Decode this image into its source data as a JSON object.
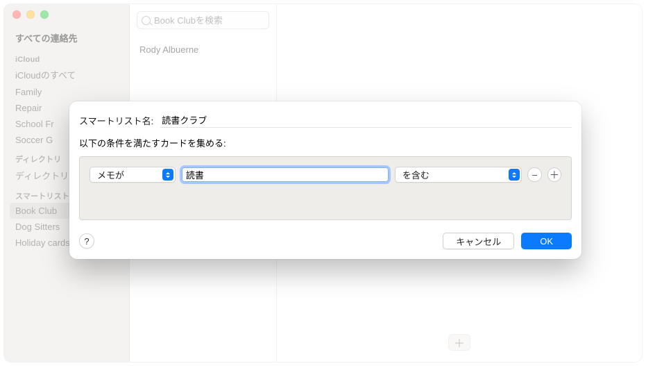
{
  "sidebar": {
    "title": "すべての連絡先",
    "sections": [
      {
        "label": "iCloud",
        "items": [
          "iCloudのすべて",
          "Family",
          "Repair",
          "School Fr",
          "Soccer G"
        ]
      },
      {
        "label": "ディレクトリ",
        "items": [
          "ディレクトリ"
        ]
      },
      {
        "label": "スマートリスト",
        "items": [
          "Book Club",
          "Dog Sitters",
          "Holiday cards"
        ],
        "selectedIndex": 0
      }
    ]
  },
  "search": {
    "placeholder": "Book Clubを検索"
  },
  "contactList": {
    "items": [
      "Rody Albuerne"
    ]
  },
  "dialog": {
    "nameLabel": "スマートリスト名:",
    "nameValue": "読書クラブ",
    "instruction": "以下の条件を満たすカードを集める:",
    "rule": {
      "fieldSelection": "メモが",
      "value": "読書",
      "operatorSelection": "を含む"
    },
    "helpLabel": "?",
    "cancelLabel": "キャンセル",
    "okLabel": "OK"
  },
  "addButtonGlyph": "＋",
  "minusGlyph": "−",
  "plusGlyph": "＋"
}
